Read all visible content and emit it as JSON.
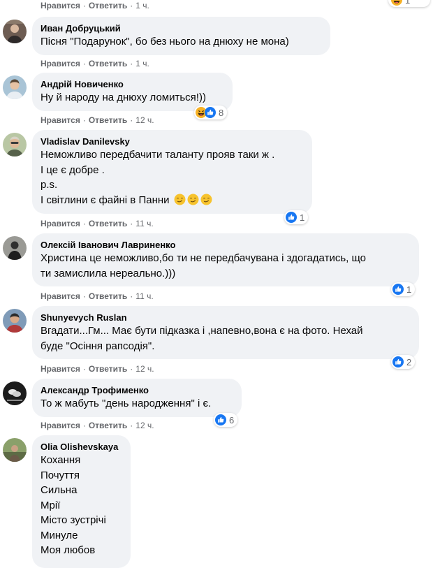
{
  "labels": {
    "like": "Нравится",
    "reply": "Ответить",
    "dot": "·"
  },
  "top": {
    "time": "1 ч.",
    "reaction_count": "1"
  },
  "comments": [
    {
      "author": "Иван Добруцький",
      "lines": [
        "Пісня \"Подарунок\", бо без нього на днюху не мона)"
      ],
      "time": "1 ч.",
      "reactions": null
    },
    {
      "author": "Андрій Новиченко",
      "lines": [
        "Ну й народу на днюху ломиться!))"
      ],
      "time": "12 ч.",
      "reactions": {
        "icons": [
          "haha-icon",
          "like-icon"
        ],
        "count": "8"
      }
    },
    {
      "author": "Vladislav Danilevsky",
      "lines": [
        "Неможливо передбачити таланту прояв таки ж .",
        "І це є добре .",
        "p.s.",
        "І світлини є файні в Панни"
      ],
      "emoji_after_last": [
        "smirk-emoji",
        "smirk-emoji",
        "smirk-emoji"
      ],
      "time": "11 ч.",
      "reactions": {
        "icons": [
          "like-icon"
        ],
        "count": "1"
      }
    },
    {
      "author": "Олексій Іванович Лавриненко",
      "lines": [
        "Христина це неможливо,бо ти не передбачувана і здогадатись, що",
        "ти замислила нереально.)))"
      ],
      "time": "11 ч.",
      "reactions": {
        "icons": [
          "like-icon"
        ],
        "count": "1"
      }
    },
    {
      "author": "Shunyevych Ruslan",
      "lines": [
        "Вгадати...Гм... Має бути підказка і ,напевно,вона є на фото. Нехай",
        "буде \"Осіння рапсодія\"."
      ],
      "time": "12 ч.",
      "reactions": {
        "icons": [
          "like-icon"
        ],
        "count": "2"
      }
    },
    {
      "author": "Александр Трофименко",
      "lines": [
        "То ж мабуть \"день народження\" і є."
      ],
      "time": "12 ч.",
      "reactions": {
        "icons": [
          "like-icon"
        ],
        "count": "6"
      }
    },
    {
      "author": "Olia Olishevskaya",
      "lines": [
        "Кохання",
        "Почуття",
        "Сильна",
        "Мрії",
        "Місто зустрічі",
        "Минуле",
        "Моя любов"
      ],
      "time": "",
      "reactions": null
    }
  ],
  "colors": {
    "bubble": "#f0f2f5",
    "meta": "#65676b",
    "like_blue": "#1877f2",
    "haha_yellow": "#f7b125"
  }
}
